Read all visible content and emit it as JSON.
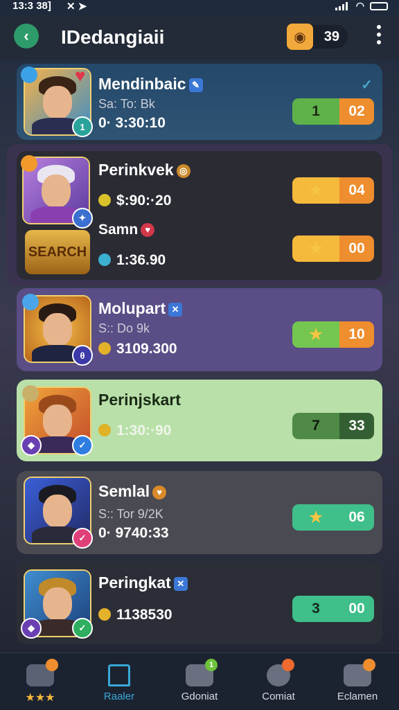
{
  "status": {
    "time": "13:3 38]",
    "glyphs": "✕ ➤"
  },
  "header": {
    "title": "IDedangiaii",
    "coins": "39",
    "back_icon": "arrow-left-icon",
    "menu_icon": "more-vertical-icon"
  },
  "colors": {
    "green": "#5fb24a",
    "orange": "#ee8e2e",
    "yellow": "#f5b93c",
    "teal": "#3fbf8a",
    "dark_green": "#3e6a3a"
  },
  "players": [
    {
      "name": "Mendinbaic",
      "sub": "Sa: To: Bk",
      "stat": "0· 3:30:10",
      "score_left": "1",
      "score_right": "02",
      "check": "✓"
    },
    {
      "name": "Perinkvek",
      "stat": "$:90:·20",
      "score_left": "★",
      "score_right": "04",
      "extra_name": "Samn",
      "extra_stat": "1:36.90",
      "extra_score_left": "★",
      "extra_score_right": "00",
      "emblem": "SEARCH"
    },
    {
      "name": "Molupart",
      "sub": "S:: Do 9k",
      "stat": "3109.300",
      "score_left": "★",
      "score_right": "10"
    },
    {
      "name": "Perinjskart",
      "stat": "1:30:·90",
      "score_left": "7",
      "score_right": "33"
    },
    {
      "name": "Semlal",
      "sub": "S:: Tor 9/2K",
      "stat": "0· 9740:33",
      "score_left": "★",
      "score_right": "06"
    },
    {
      "name": "Peringkat",
      "stat": "1138530",
      "score_left": "3",
      "score_right": "00"
    }
  ],
  "nav": [
    {
      "label": "",
      "icon": "castle-icon",
      "stars": "★★★"
    },
    {
      "label": "Raaler",
      "icon": "home-icon"
    },
    {
      "label": "Gdoniat",
      "icon": "check-shield-icon",
      "badge": "1"
    },
    {
      "label": "Comiat",
      "icon": "chat-icon"
    },
    {
      "label": "Eclamen",
      "icon": "inbox-icon"
    }
  ]
}
